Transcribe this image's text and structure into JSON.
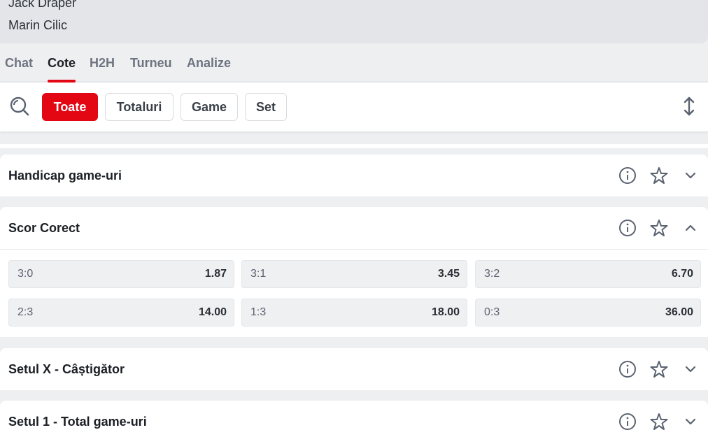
{
  "match": {
    "player1": "Jack Draper",
    "player2": "Marin Cilic"
  },
  "tabs": [
    {
      "label": "Chat"
    },
    {
      "label": "Cote",
      "active": true
    },
    {
      "label": "H2H"
    },
    {
      "label": "Turneu"
    },
    {
      "label": "Analize"
    }
  ],
  "filters": {
    "chips": [
      {
        "label": "Toate",
        "active": true
      },
      {
        "label": "Totaluri"
      },
      {
        "label": "Game"
      },
      {
        "label": "Set"
      }
    ],
    "search_icon": "search-icon",
    "sort_icon": "expand-collapse-icon"
  },
  "markets": [
    {
      "title": "Handicap game-uri",
      "expanded": false
    },
    {
      "title": "Scor Corect",
      "expanded": true,
      "odds": [
        {
          "label": "3:0",
          "value": "1.87"
        },
        {
          "label": "3:1",
          "value": "3.45"
        },
        {
          "label": "3:2",
          "value": "6.70"
        },
        {
          "label": "2:3",
          "value": "14.00"
        },
        {
          "label": "1:3",
          "value": "18.00"
        },
        {
          "label": "0:3",
          "value": "36.00"
        }
      ]
    },
    {
      "title": "Setul X - Câștigător",
      "expanded": false
    },
    {
      "title": "Setul 1 - Total game-uri",
      "expanded": false
    }
  ],
  "colors": {
    "accent": "#e30613",
    "background": "#eeeff1",
    "card": "#ffffff"
  }
}
